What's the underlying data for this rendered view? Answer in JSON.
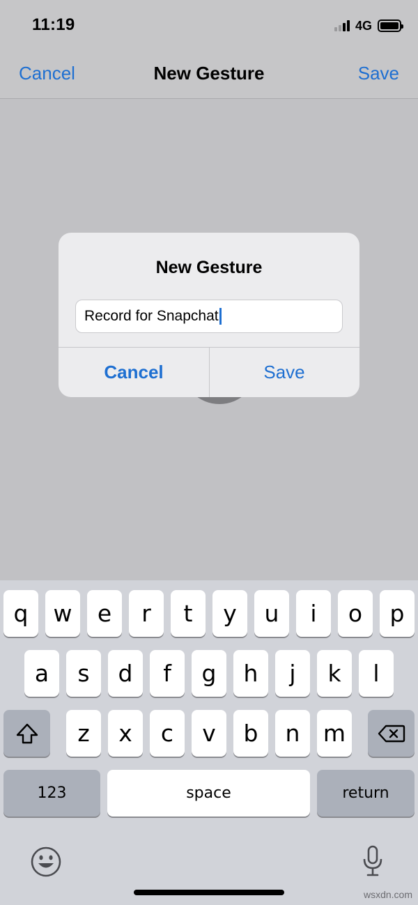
{
  "status_bar": {
    "time": "11:19",
    "network": "4G",
    "signal_bars": 4,
    "signal_bars_active": 2
  },
  "nav_bar": {
    "cancel_label": "Cancel",
    "title": "New Gesture",
    "save_label": "Save"
  },
  "alert": {
    "title": "New Gesture",
    "input_value": "Record for Snapchat",
    "cancel_label": "Cancel",
    "save_label": "Save"
  },
  "keyboard": {
    "row1": [
      "q",
      "w",
      "e",
      "r",
      "t",
      "y",
      "u",
      "i",
      "o",
      "p"
    ],
    "row2": [
      "a",
      "s",
      "d",
      "f",
      "g",
      "h",
      "j",
      "k",
      "l"
    ],
    "row3": [
      "z",
      "x",
      "c",
      "v",
      "b",
      "n",
      "m"
    ],
    "numbers_label": "123",
    "space_label": "space",
    "return_label": "return",
    "icons": [
      "shift-icon",
      "backspace-icon",
      "emoji-icon",
      "microphone-icon"
    ]
  },
  "watermark": "wsxdn.com",
  "colors": {
    "accent": "#1e6fd1",
    "keyboard_bg": "#d1d3d9",
    "func_key": "#abb0ba"
  }
}
